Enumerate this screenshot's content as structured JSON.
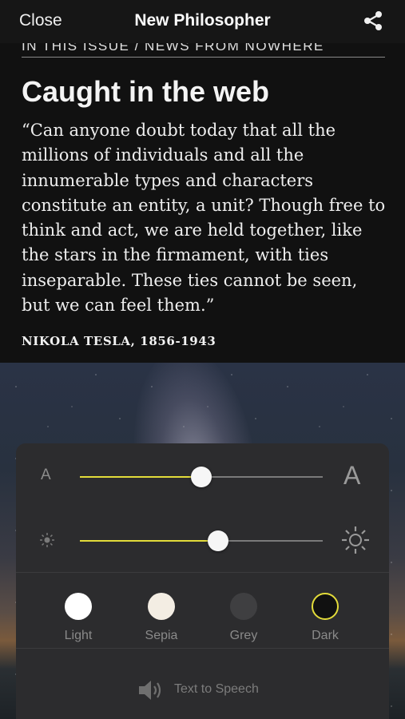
{
  "navbar": {
    "close_label": "Close",
    "title": "New Philosopher",
    "share_icon": "share-icon"
  },
  "article": {
    "kicker": "IN THIS ISSUE / NEWS FROM NOWHERE",
    "headline": "Caught in the web",
    "quote": "“Can anyone doubt today that all the millions of individuals and all the innumerable types and characters constitute an entity, a unit? Though free to think and act, we are held together, like the stars in the firmament, with ties inseparable. These ties cannot be seen, but we can feel them.”",
    "attribution": "NIKOLA TESLA, 1856-1943"
  },
  "settings": {
    "font_size": {
      "small_label": "A",
      "large_label": "A",
      "value_fraction": 0.5
    },
    "brightness": {
      "small_icon": "sun-small-icon",
      "large_icon": "sun-large-icon",
      "value_fraction": 0.57
    },
    "accent_color": "#e3dc3a",
    "themes": [
      {
        "label": "Light",
        "color": "#ffffff",
        "selected": false
      },
      {
        "label": "Sepia",
        "color": "#f3ede3",
        "selected": false
      },
      {
        "label": "Grey",
        "color": "#3f3f41",
        "selected": false
      },
      {
        "label": "Dark",
        "color": "#111111",
        "selected": true
      }
    ],
    "text_to_speech": {
      "label": "Text to Speech",
      "icon": "speaker-icon"
    }
  }
}
